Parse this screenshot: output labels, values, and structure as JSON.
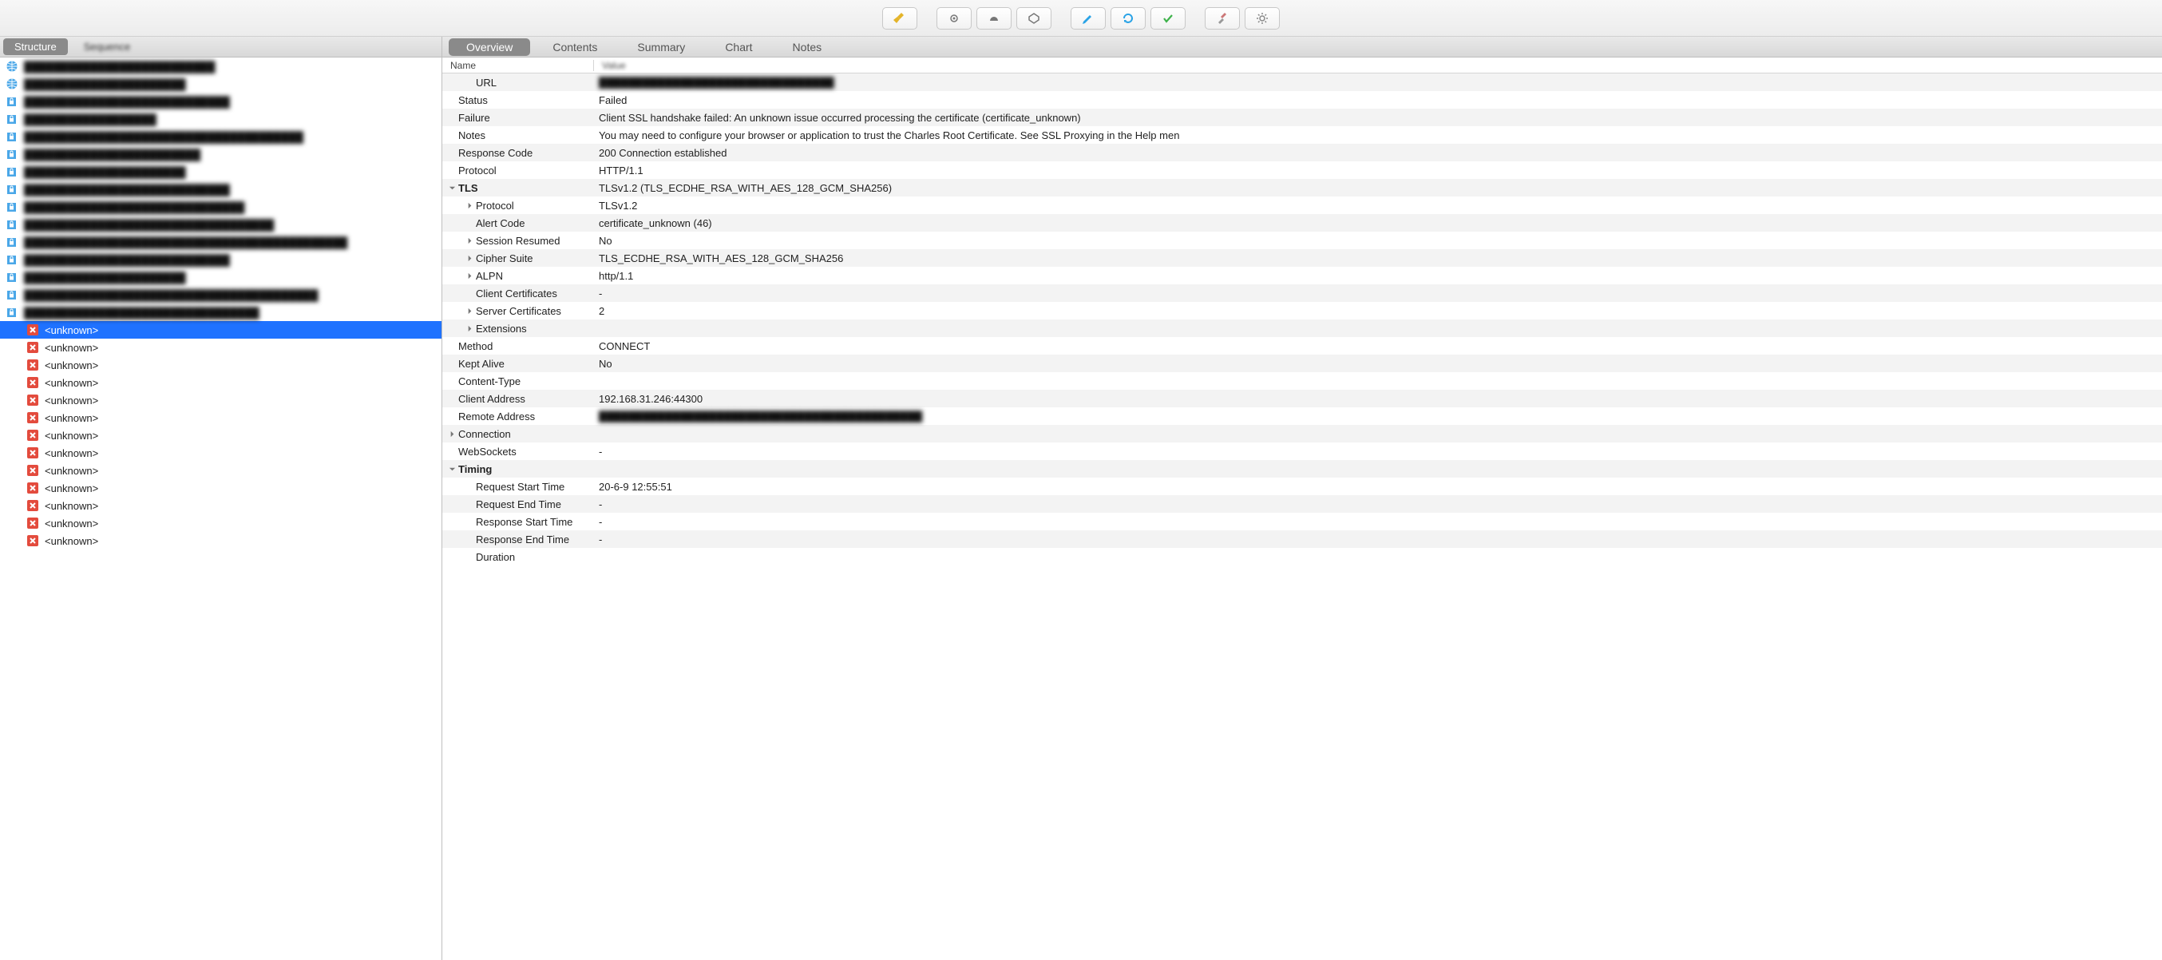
{
  "toolbar_icons": [
    {
      "name": "broom-icon",
      "color": "#d9a400"
    },
    {
      "name": "record-icon",
      "color": "#777"
    },
    {
      "name": "throttle-icon",
      "color": "#777"
    },
    {
      "name": "breakpoint-icon",
      "color": "#777"
    },
    {
      "name": "pencil-icon",
      "color": "#2aa3e6"
    },
    {
      "name": "refresh-icon",
      "color": "#2aa3e6"
    },
    {
      "name": "check-icon",
      "color": "#3db24a"
    },
    {
      "name": "tools-icon",
      "color": "#888"
    },
    {
      "name": "gear-icon",
      "color": "#888"
    }
  ],
  "left_tabs": {
    "items": [
      "Structure",
      "Sequence"
    ],
    "active": 0
  },
  "right_tabs": {
    "items": [
      "Overview",
      "Contents",
      "Summary",
      "Chart",
      "Notes"
    ],
    "active": 0
  },
  "tree": {
    "hosts": [
      {
        "icon": "globe",
        "label": "██████████████████████████",
        "blur": true
      },
      {
        "icon": "globe",
        "label": "██████████████████████",
        "blur": true
      },
      {
        "icon": "lock",
        "label": "████████████████████████████",
        "blur": true
      },
      {
        "icon": "lock",
        "label": "██████████████████",
        "blur": true
      },
      {
        "icon": "lock",
        "label": "██████████████████████████████████████",
        "blur": true
      },
      {
        "icon": "lock",
        "label": "████████████████████████",
        "blur": true
      },
      {
        "icon": "lock",
        "label": "██████████████████████",
        "blur": true
      },
      {
        "icon": "lock",
        "label": "████████████████████████████",
        "blur": true
      },
      {
        "icon": "lock",
        "label": "██████████████████████████████",
        "blur": true
      },
      {
        "icon": "lock",
        "label": "██████████████████████████████████",
        "blur": true
      },
      {
        "icon": "lock",
        "label": "████████████████████████████████████████████",
        "blur": true
      },
      {
        "icon": "lock",
        "label": "████████████████████████████",
        "blur": true
      },
      {
        "icon": "lock",
        "label": "██████████████████████",
        "blur": true
      },
      {
        "icon": "lock",
        "label": "████████████████████████████████████████",
        "blur": true
      },
      {
        "icon": "lock",
        "label": "████████████████████████████████",
        "blur": true
      }
    ],
    "unknown_label": "<unknown>",
    "unknown_selected_index": 0,
    "unknown_count": 13
  },
  "grid_header": {
    "name": "Name",
    "value": "Value"
  },
  "overview": [
    {
      "d": 1,
      "arrow": "none",
      "name": "URL",
      "value": "████████████████████████████████",
      "blur": true
    },
    {
      "d": 0,
      "arrow": "none",
      "name": "Status",
      "value": "Failed"
    },
    {
      "d": 0,
      "arrow": "none",
      "name": "Failure",
      "value": "Client SSL handshake failed: An unknown issue occurred processing the certificate (certificate_unknown)"
    },
    {
      "d": 0,
      "arrow": "none",
      "name": "Notes",
      "value": "You may need to configure your browser or application to trust the Charles Root Certificate. See SSL Proxying in the Help men"
    },
    {
      "d": 0,
      "arrow": "none",
      "name": "Response Code",
      "value": "200 Connection established"
    },
    {
      "d": 0,
      "arrow": "none",
      "name": "Protocol",
      "value": "HTTP/1.1"
    },
    {
      "d": 0,
      "arrow": "down",
      "name": "TLS",
      "value": "TLSv1.2 (TLS_ECDHE_RSA_WITH_AES_128_GCM_SHA256)",
      "bold": true
    },
    {
      "d": 1,
      "arrow": "right",
      "name": "Protocol",
      "value": "TLSv1.2"
    },
    {
      "d": 1,
      "arrow": "none",
      "name": "Alert Code",
      "value": "certificate_unknown (46)"
    },
    {
      "d": 1,
      "arrow": "right",
      "name": "Session Resumed",
      "value": "No"
    },
    {
      "d": 1,
      "arrow": "right",
      "name": "Cipher Suite",
      "value": "TLS_ECDHE_RSA_WITH_AES_128_GCM_SHA256"
    },
    {
      "d": 1,
      "arrow": "right",
      "name": "ALPN",
      "value": "http/1.1"
    },
    {
      "d": 1,
      "arrow": "none",
      "name": "Client Certificates",
      "value": "-"
    },
    {
      "d": 1,
      "arrow": "right",
      "name": "Server Certificates",
      "value": "2"
    },
    {
      "d": 1,
      "arrow": "right",
      "name": "Extensions",
      "value": ""
    },
    {
      "d": 0,
      "arrow": "none",
      "name": "Method",
      "value": "CONNECT"
    },
    {
      "d": 0,
      "arrow": "none",
      "name": "Kept Alive",
      "value": "No"
    },
    {
      "d": 0,
      "arrow": "none",
      "name": "Content-Type",
      "value": ""
    },
    {
      "d": 0,
      "arrow": "none",
      "name": "Client Address",
      "value": "192.168.31.246:44300"
    },
    {
      "d": 0,
      "arrow": "none",
      "name": "Remote Address",
      "value": "████████████████████████████████████████████",
      "blur": true
    },
    {
      "d": 0,
      "arrow": "right",
      "name": "Connection",
      "value": ""
    },
    {
      "d": 0,
      "arrow": "none",
      "name": "WebSockets",
      "value": "-"
    },
    {
      "d": 0,
      "arrow": "down",
      "name": "Timing",
      "value": "",
      "bold": true
    },
    {
      "d": 1,
      "arrow": "none",
      "name": "Request Start Time",
      "value": "20-6-9 12:55:51"
    },
    {
      "d": 1,
      "arrow": "none",
      "name": "Request End Time",
      "value": "-"
    },
    {
      "d": 1,
      "arrow": "none",
      "name": "Response Start Time",
      "value": "-"
    },
    {
      "d": 1,
      "arrow": "none",
      "name": "Response End Time",
      "value": "-"
    },
    {
      "d": 1,
      "arrow": "none",
      "name": "Duration",
      "value": ""
    }
  ]
}
